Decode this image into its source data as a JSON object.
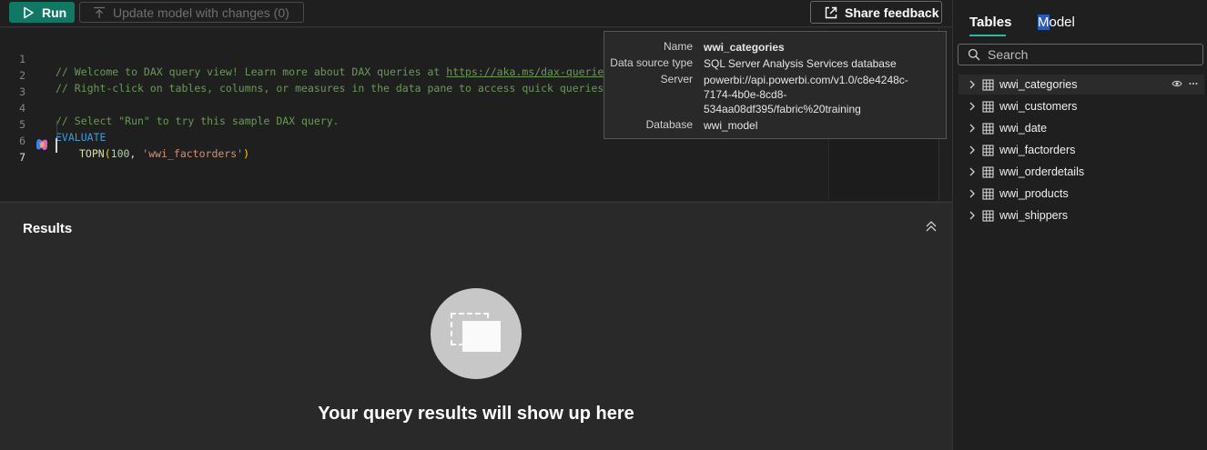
{
  "toolbar": {
    "run_label": "Run",
    "update_label": "Update model with changes (0)",
    "feedback_label": "Share feedback"
  },
  "editor": {
    "line_numbers": [
      "1",
      "2",
      "3",
      "4",
      "5",
      "6",
      "7"
    ],
    "line1_comment": "// Welcome to DAX query view! Learn more about DAX queries at ",
    "line1_url": "https://aka.ms/dax-queries",
    "line1_end": ".",
    "line2_comment": "// Right-click on tables, columns, or measures in the data pane to access quick queries, or",
    "line4_comment": "// Select \"Run\" to try this sample DAX query.",
    "line5_keyword": "EVALUATE",
    "line6_fn": "TOPN",
    "line6_open": "(",
    "line6_num": "100",
    "line6_sep": ", ",
    "line6_str": "'wwi_factorders'",
    "line6_close": ")"
  },
  "results": {
    "title": "Results",
    "empty_message": "Your query results will show up here"
  },
  "pane": {
    "tab_tables": "Tables",
    "tab_model_hl": "M",
    "tab_model_rest": "odel",
    "search_placeholder": "Search",
    "tables": [
      "wwi_categories",
      "wwi_customers",
      "wwi_date",
      "wwi_factorders",
      "wwi_orderdetails",
      "wwi_products",
      "wwi_shippers"
    ]
  },
  "tooltip": {
    "name_label": "Name",
    "name_value": "wwi_categories",
    "source_label": "Data source type",
    "source_value": "SQL Server Analysis Services database",
    "server_label": "Server",
    "server_value_1": "powerbi://api.powerbi.com/v1.0/c8e4248c-",
    "server_value_2": "7174-4b0e-8cd8-",
    "server_value_3": "534aa08df395/fabric%20training",
    "database_label": "Database",
    "database_value": "wwi_model"
  },
  "colors": {
    "run_button": "#117865",
    "tab_accent": "#2fb8a1",
    "comment": "#6a9955",
    "keyword": "#3e9cd6"
  }
}
